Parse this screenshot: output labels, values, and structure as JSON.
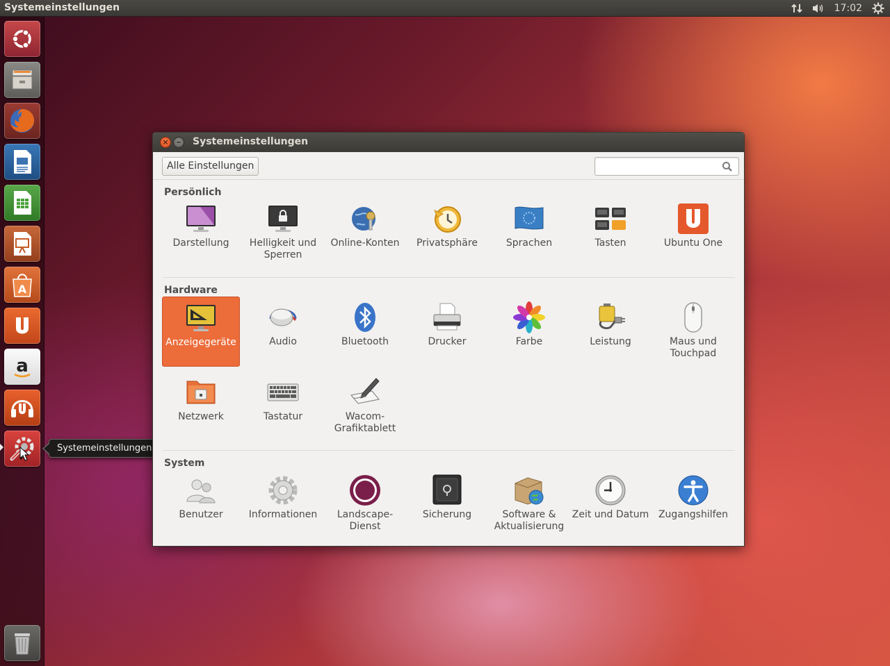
{
  "top_panel": {
    "app_title": "Systemeinstellungen",
    "clock": "17:02",
    "icons": [
      "network-icon",
      "volume-icon",
      "session-gear-icon"
    ]
  },
  "launcher": {
    "items": [
      {
        "name": "ubuntu-dash",
        "icon": "ubuntu-logo-icon"
      },
      {
        "name": "files",
        "icon": "file-cabinet-icon"
      },
      {
        "name": "firefox",
        "icon": "firefox-icon"
      },
      {
        "name": "libreoffice-writer",
        "icon": "writer-document-icon"
      },
      {
        "name": "libreoffice-calc",
        "icon": "calc-spreadsheet-icon"
      },
      {
        "name": "libreoffice-impress",
        "icon": "impress-presentation-icon"
      },
      {
        "name": "software-center",
        "icon": "shopping-bag-icon"
      },
      {
        "name": "ubuntu-one",
        "icon": "ubuntu-one-icon"
      },
      {
        "name": "amazon",
        "icon": "amazon-icon"
      },
      {
        "name": "ubuntu-one-music",
        "icon": "headphones-icon"
      },
      {
        "name": "system-settings",
        "icon": "settings-wrench-icon"
      },
      {
        "name": "trash",
        "icon": "trash-icon"
      }
    ],
    "tooltip": "Systemeinstellungen"
  },
  "window": {
    "title": "Systemeinstellungen",
    "all_settings_label": "Alle Einstellungen",
    "search_value": "",
    "sections": [
      {
        "title": "Persönlich",
        "items": [
          {
            "label": "Darstellung",
            "icon": "appearance-icon"
          },
          {
            "label": "Helligkeit und Sperren",
            "icon": "brightness-lock-icon"
          },
          {
            "label": "Online-Konten",
            "icon": "online-accounts-icon"
          },
          {
            "label": "Privatsphäre",
            "icon": "privacy-icon"
          },
          {
            "label": "Sprachen",
            "icon": "language-flag-icon"
          },
          {
            "label": "Tasten",
            "icon": "keyboard-keys-icon"
          },
          {
            "label": "Ubuntu One",
            "icon": "ubuntu-one-icon"
          }
        ]
      },
      {
        "title": "Hardware",
        "items": [
          {
            "label": "Anzeigegeräte",
            "icon": "display-icon",
            "selected": true
          },
          {
            "label": "Audio",
            "icon": "audio-icon"
          },
          {
            "label": "Bluetooth",
            "icon": "bluetooth-icon"
          },
          {
            "label": "Drucker",
            "icon": "printer-icon"
          },
          {
            "label": "Farbe",
            "icon": "color-icon"
          },
          {
            "label": "Leistung",
            "icon": "power-battery-icon"
          },
          {
            "label": "Maus und Touchpad",
            "icon": "mouse-icon"
          },
          {
            "label": "Netzwerk",
            "icon": "network-folder-icon"
          },
          {
            "label": "Tastatur",
            "icon": "keyboard-icon"
          },
          {
            "label": "Wacom-Grafiktablett",
            "icon": "wacom-tablet-icon"
          }
        ]
      },
      {
        "title": "System",
        "items": [
          {
            "label": "Benutzer",
            "icon": "users-icon"
          },
          {
            "label": "Informationen",
            "icon": "info-gear-icon"
          },
          {
            "label": "Landscape-Dienst",
            "icon": "landscape-icon"
          },
          {
            "label": "Sicherung",
            "icon": "backup-safe-icon"
          },
          {
            "label": "Software & Aktualisierung",
            "icon": "software-update-icon"
          },
          {
            "label": "Zeit und Datum",
            "icon": "clock-icon"
          },
          {
            "label": "Zugangshilfen",
            "icon": "accessibility-icon"
          }
        ]
      }
    ]
  },
  "colors": {
    "selection": "#ec6c3a",
    "panel": "#3c3b37",
    "window_bg": "#f2f1f0"
  }
}
